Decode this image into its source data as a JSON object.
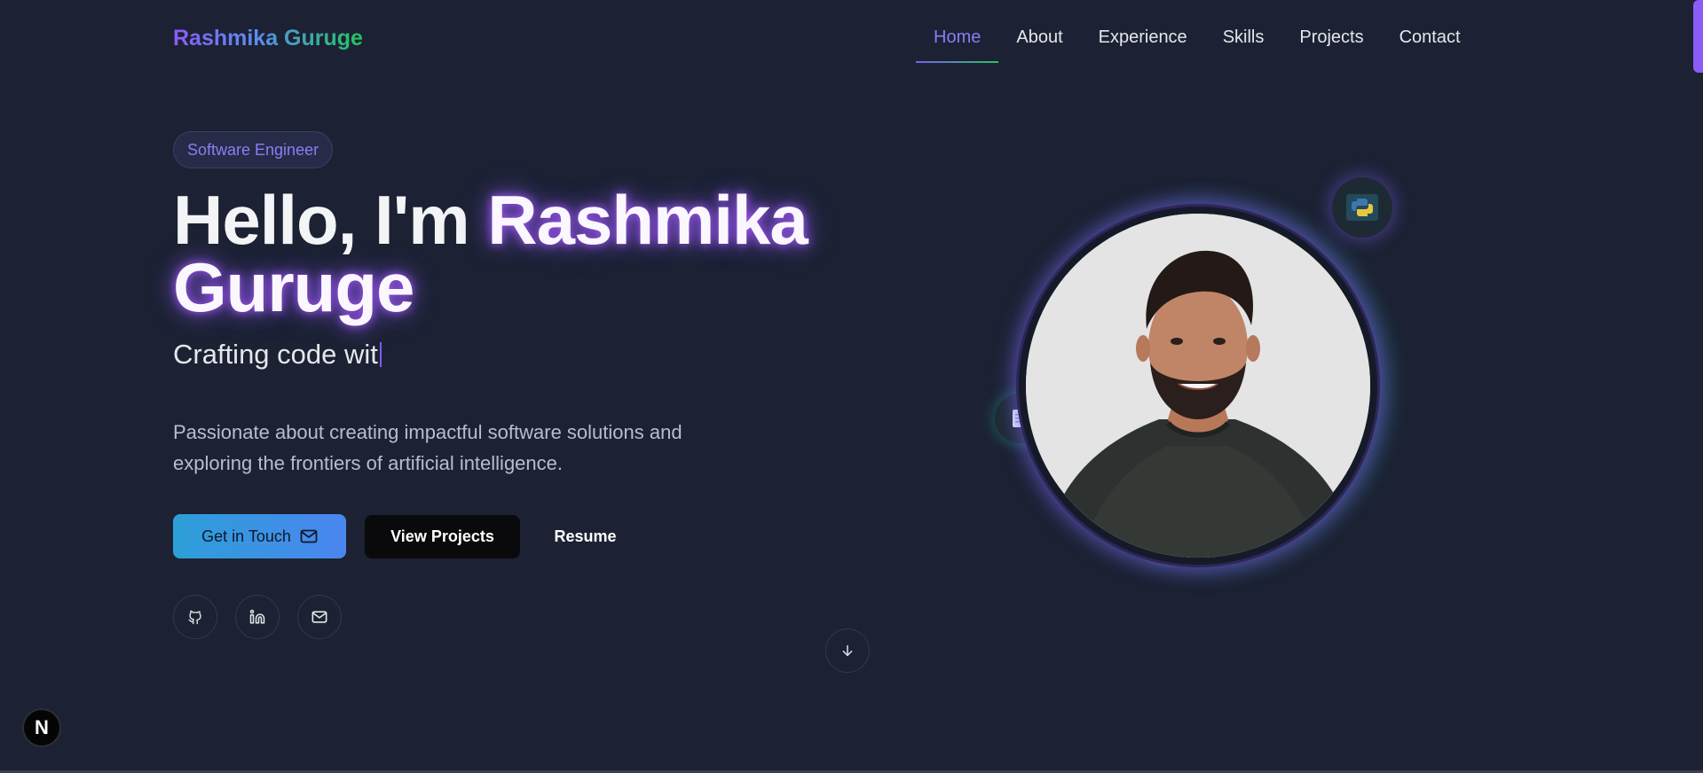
{
  "brand": "Rashmika Guruge",
  "nav": {
    "items": [
      {
        "label": "Home"
      },
      {
        "label": "About"
      },
      {
        "label": "Experience"
      },
      {
        "label": "Skills"
      },
      {
        "label": "Projects"
      },
      {
        "label": "Contact"
      }
    ],
    "active": "Home"
  },
  "hero": {
    "badge": "Software Engineer",
    "headline_prefix": "Hello, I'm ",
    "headline_name_first": "Rashmika",
    "headline_name_last": "Guruge",
    "typed_text": "Crafting code wit",
    "intro_line1": "Passionate about creating impactful software solutions and",
    "intro_line2": "exploring the frontiers of artificial intelligence.",
    "buttons": {
      "touch": "Get in Touch",
      "projects": "View Projects",
      "resume": "Resume"
    }
  },
  "social": {
    "github_icon": "github-icon",
    "linkedin_icon": "linkedin-icon",
    "mail_icon": "mail-icon"
  },
  "icons": {
    "scroll": "arrow-down-icon",
    "python": "python-icon",
    "document": "document-icon",
    "dev_indicator": "N"
  },
  "colors": {
    "background": "#1c2233",
    "accent_purple": "#8b5cf6",
    "accent_green": "#22c55e",
    "accent_blue": "#4a86f0"
  }
}
